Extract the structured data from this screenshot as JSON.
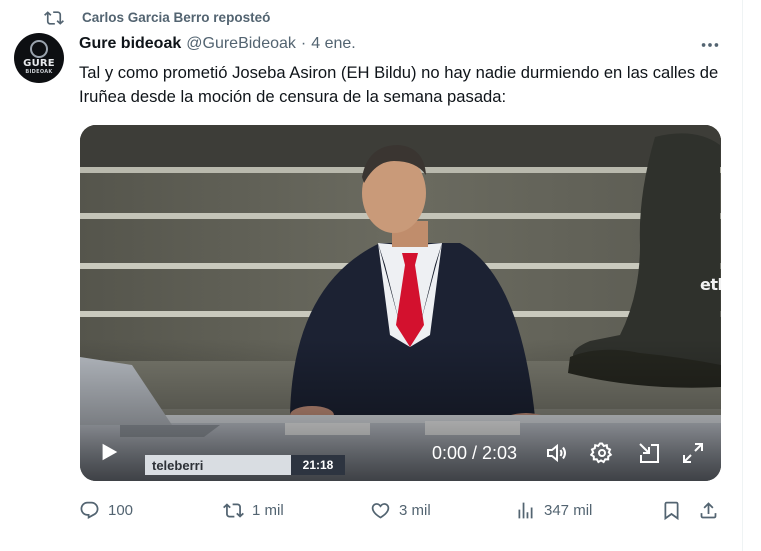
{
  "repost": {
    "icon": "repost-icon",
    "text": "Carlos Garcia Berro reposteó"
  },
  "avatar": {
    "line1": "GURE",
    "line2": "BIDEOAK"
  },
  "author": {
    "name": "Gure bideoak",
    "handle": "@GureBideoak",
    "separator": "·",
    "date": "4 ene."
  },
  "tweet": {
    "text": "Tal y como prometió Joseba Asiron (EH Bildu) no hay nadie durmiendo en las calles de Iruñea desde la moción de censura de la semana pasada:"
  },
  "video": {
    "channel_logo": "etb",
    "time_display": "0:00 / 2:03",
    "lower_third_brand": "teleberri",
    "lower_third_time": "21:18",
    "controls": [
      "play-icon",
      "volume-icon",
      "settings-icon",
      "pip-icon",
      "fullscreen-icon"
    ]
  },
  "actions": {
    "replies": "100",
    "reposts": "1 mil",
    "likes": "3 mil",
    "views": "347 mil"
  },
  "colors": {
    "text": "#0f1419",
    "secondary": "#536471",
    "border": "#eff3f4",
    "tie": "#d3112e"
  }
}
